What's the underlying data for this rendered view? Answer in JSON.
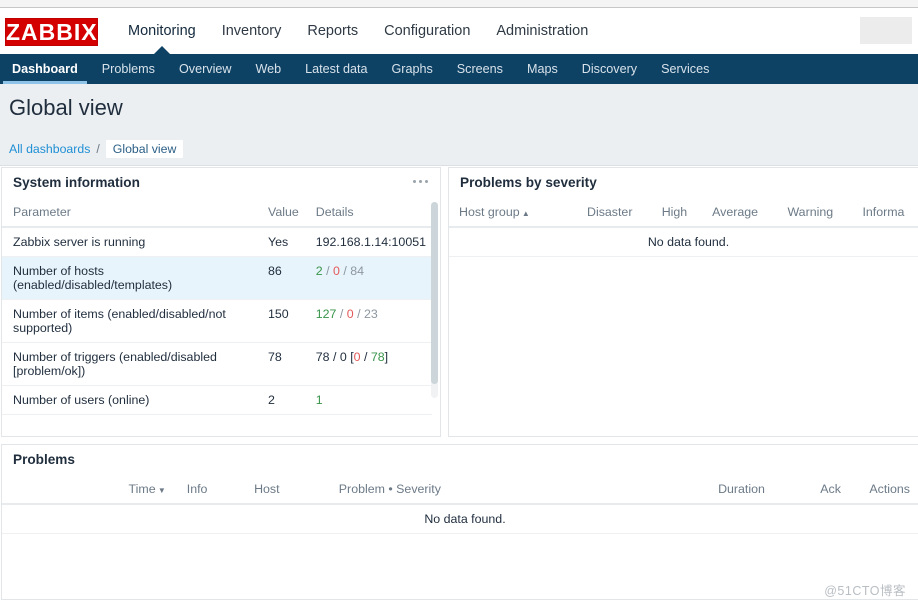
{
  "brand": {
    "logo_text": "ZABBIX",
    "logo_bg": "#d40000"
  },
  "header": {
    "menu": [
      {
        "label": "Monitoring",
        "selected": true
      },
      {
        "label": "Inventory",
        "selected": false
      },
      {
        "label": "Reports",
        "selected": false
      },
      {
        "label": "Configuration",
        "selected": false
      },
      {
        "label": "Administration",
        "selected": false
      }
    ]
  },
  "subnav": {
    "items": [
      {
        "label": "Dashboard",
        "selected": true
      },
      {
        "label": "Problems",
        "selected": false
      },
      {
        "label": "Overview",
        "selected": false
      },
      {
        "label": "Web",
        "selected": false
      },
      {
        "label": "Latest data",
        "selected": false
      },
      {
        "label": "Graphs",
        "selected": false
      },
      {
        "label": "Screens",
        "selected": false
      },
      {
        "label": "Maps",
        "selected": false
      },
      {
        "label": "Discovery",
        "selected": false
      },
      {
        "label": "Services",
        "selected": false
      }
    ],
    "bg": "#0e4265"
  },
  "page": {
    "title": "Global view",
    "breadcrumb": {
      "root": "All dashboards",
      "separator": "/",
      "current": "Global view"
    }
  },
  "system_information": {
    "title": "System information",
    "columns": [
      "Parameter",
      "Value",
      "Details"
    ],
    "rows": [
      {
        "parameter": "Zabbix server is running",
        "value": "Yes",
        "value_color": "green",
        "details": [
          {
            "text": "192.168.1.14:10051",
            "color": "dark"
          }
        ],
        "highlighted": false
      },
      {
        "parameter": "Number of hosts (enabled/disabled/templates)",
        "value": "86",
        "value_color": "dark",
        "details": [
          {
            "text": "2",
            "color": "green"
          },
          {
            "text": " / ",
            "color": "gray"
          },
          {
            "text": "0",
            "color": "red"
          },
          {
            "text": " / ",
            "color": "gray"
          },
          {
            "text": "84",
            "color": "gray"
          }
        ],
        "highlighted": true
      },
      {
        "parameter": "Number of items (enabled/disabled/not supported)",
        "value": "150",
        "value_color": "dark",
        "details": [
          {
            "text": "127",
            "color": "green"
          },
          {
            "text": " / ",
            "color": "gray"
          },
          {
            "text": "0",
            "color": "red"
          },
          {
            "text": " / ",
            "color": "gray"
          },
          {
            "text": "23",
            "color": "gray"
          }
        ],
        "highlighted": false
      },
      {
        "parameter": "Number of triggers (enabled/disabled [problem/ok])",
        "value": "78",
        "value_color": "dark",
        "details": [
          {
            "text": "78 / 0 [",
            "color": "dark"
          },
          {
            "text": "0",
            "color": "red"
          },
          {
            "text": " / ",
            "color": "dark"
          },
          {
            "text": "78",
            "color": "green"
          },
          {
            "text": "]",
            "color": "dark"
          }
        ],
        "highlighted": false
      },
      {
        "parameter": "Number of users (online)",
        "value": "2",
        "value_color": "dark",
        "details": [
          {
            "text": "1",
            "color": "green"
          }
        ],
        "highlighted": false
      }
    ]
  },
  "problems_by_severity": {
    "title": "Problems by severity",
    "columns": [
      "Host group",
      "Disaster",
      "High",
      "Average",
      "Warning",
      "Informa"
    ],
    "sort_column": "Host group",
    "sort_direction": "asc",
    "empty_message": "No data found."
  },
  "problems": {
    "title": "Problems",
    "columns": [
      "Time",
      "Info",
      "Host",
      "Problem • Severity",
      "Duration",
      "Ack",
      "Actions"
    ],
    "sort_column": "Time",
    "sort_direction": "desc",
    "empty_message": "No data found."
  },
  "watermark": "@51CTO博客"
}
